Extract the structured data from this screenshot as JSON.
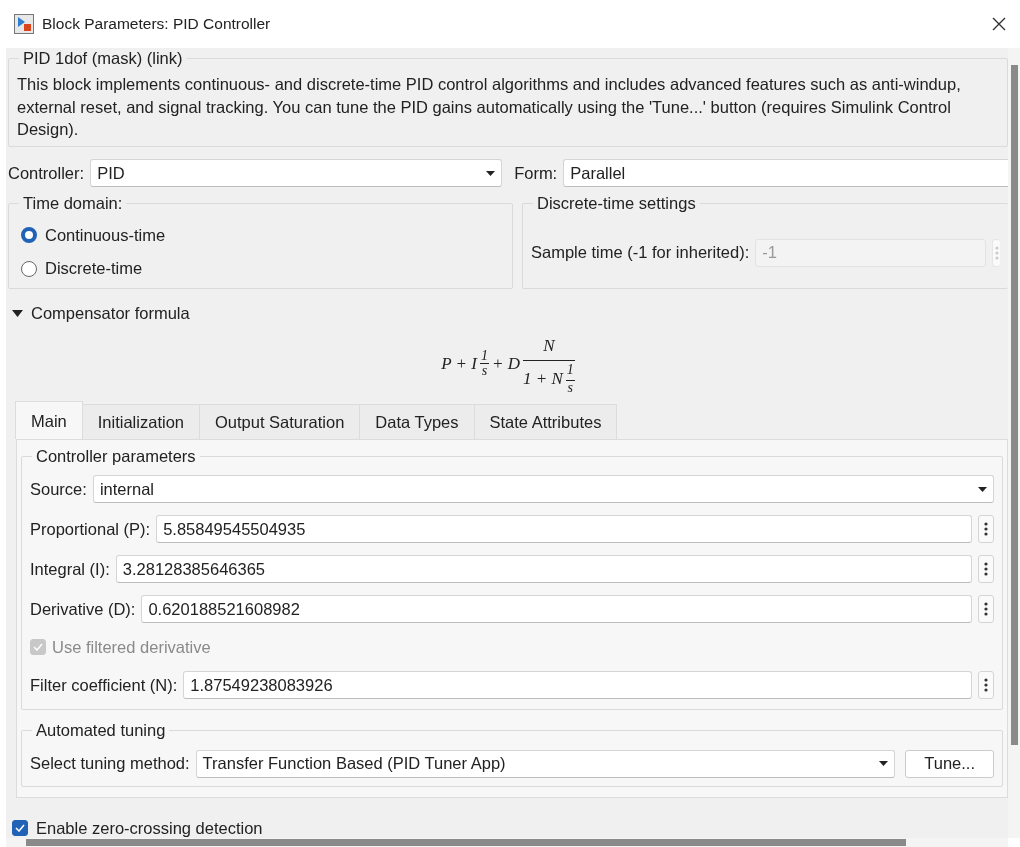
{
  "window": {
    "title": "Block Parameters: PID Controller"
  },
  "mask": {
    "title": "PID 1dof (mask) (link)",
    "description": "This block implements continuous- and discrete-time PID control algorithms and includes advanced features such as anti-windup, external reset, and signal tracking. You can tune the PID gains automatically using the 'Tune...' button (requires Simulink Control Design)."
  },
  "controller": {
    "label": "Controller:",
    "value": "PID"
  },
  "form": {
    "label": "Form:",
    "value": "Parallel"
  },
  "time_domain": {
    "title": "Time domain:",
    "options": [
      {
        "label": "Continuous-time",
        "selected": true
      },
      {
        "label": "Discrete-time",
        "selected": false
      }
    ]
  },
  "discrete_settings": {
    "title": "Discrete-time settings",
    "sample_time": {
      "label": "Sample time (-1 for inherited):",
      "value": "-1",
      "disabled": true
    }
  },
  "compensator": {
    "label": "Compensator formula",
    "expanded": true,
    "formula": [
      {
        "kind": "text",
        "text": "P + I"
      },
      {
        "kind": "frac",
        "num": "1",
        "den": "s"
      },
      {
        "kind": "text",
        "text": "+ D"
      },
      {
        "kind": "bigfrac",
        "num": "N",
        "den": [
          {
            "kind": "text",
            "text": "1 + N"
          },
          {
            "kind": "frac",
            "num": "1",
            "den": "s"
          }
        ]
      }
    ]
  },
  "tabs": [
    {
      "label": "Main",
      "selected": true
    },
    {
      "label": "Initialization",
      "selected": false
    },
    {
      "label": "Output Saturation",
      "selected": false
    },
    {
      "label": "Data Types",
      "selected": false
    },
    {
      "label": "State Attributes",
      "selected": false
    }
  ],
  "controller_parameters": {
    "title": "Controller parameters",
    "fields": [
      {
        "kind": "dropdown",
        "label": "Source:",
        "value": "internal"
      },
      {
        "kind": "text",
        "label": "Proportional (P):",
        "value": "5.85849545504935"
      },
      {
        "kind": "text",
        "label": "Integral (I):",
        "value": "3.28128385646365"
      },
      {
        "kind": "text",
        "label": "Derivative (D):",
        "value": "0.620188521608982"
      },
      {
        "kind": "checkbox",
        "label": "Use filtered derivative",
        "checked": true,
        "disabled": true
      },
      {
        "kind": "text",
        "label": "Filter coefficient (N):",
        "value": "1.87549238083926"
      }
    ]
  },
  "automated_tuning": {
    "title": "Automated tuning",
    "method": {
      "label": "Select tuning method:",
      "value": "Transfer Function Based (PID Tuner App)"
    },
    "tune_button": "Tune..."
  },
  "zero_crossing": {
    "label": "Enable zero-crossing detection",
    "checked": true
  }
}
